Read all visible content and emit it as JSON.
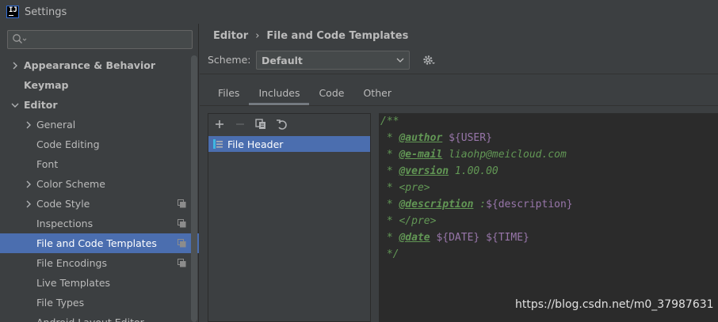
{
  "window": {
    "title": "Settings",
    "logo_text": "IJ"
  },
  "sidebar": {
    "search": {
      "value": "",
      "placeholder": ""
    },
    "items": [
      {
        "label": "Appearance & Behavior",
        "bold": true,
        "chevron": "right",
        "indent": 0
      },
      {
        "label": "Keymap",
        "bold": true,
        "chevron": "",
        "indent": 0
      },
      {
        "label": "Editor",
        "bold": true,
        "chevron": "down",
        "indent": 0
      },
      {
        "label": "General",
        "bold": false,
        "chevron": "right",
        "indent": 1
      },
      {
        "label": "Code Editing",
        "bold": false,
        "chevron": "",
        "indent": 1
      },
      {
        "label": "Font",
        "bold": false,
        "chevron": "",
        "indent": 1
      },
      {
        "label": "Color Scheme",
        "bold": false,
        "chevron": "right",
        "indent": 1
      },
      {
        "label": "Code Style",
        "bold": false,
        "chevron": "right",
        "indent": 1,
        "copy_icon": true
      },
      {
        "label": "Inspections",
        "bold": false,
        "chevron": "",
        "indent": 1,
        "copy_icon": true
      },
      {
        "label": "File and Code Templates",
        "bold": false,
        "chevron": "",
        "indent": 1,
        "copy_icon": true,
        "selected": true
      },
      {
        "label": "File Encodings",
        "bold": false,
        "chevron": "",
        "indent": 1,
        "copy_icon": true
      },
      {
        "label": "Live Templates",
        "bold": false,
        "chevron": "",
        "indent": 1
      },
      {
        "label": "File Types",
        "bold": false,
        "chevron": "",
        "indent": 1
      },
      {
        "label": "Android Layout Editor",
        "bold": false,
        "chevron": "",
        "indent": 1
      }
    ]
  },
  "main": {
    "breadcrumb": {
      "parent": "Editor",
      "separator": "›",
      "current": "File and Code Templates"
    },
    "scheme": {
      "label": "Scheme:",
      "value": "Default"
    },
    "tabs": [
      {
        "label": "Files",
        "active": false
      },
      {
        "label": "Includes",
        "active": true
      },
      {
        "label": "Code",
        "active": false
      },
      {
        "label": "Other",
        "active": false
      }
    ],
    "templates": [
      {
        "label": "File Header",
        "selected": true
      }
    ],
    "editor_lines": [
      {
        "prefix": "/**",
        "tag": "",
        "text": "",
        "vars": []
      },
      {
        "prefix": " * ",
        "tag": "@author",
        "text": " ",
        "var": "${USER}"
      },
      {
        "prefix": " * ",
        "tag": "@e-mail",
        "text": " liaohp@meicloud.com",
        "var": ""
      },
      {
        "prefix": " * ",
        "tag": "@version",
        "text": " 1.00.00",
        "var": ""
      },
      {
        "prefix": " * <pre>",
        "tag": "",
        "text": "",
        "var": ""
      },
      {
        "prefix": " * ",
        "tag": "@description",
        "text": " :",
        "var": "${description}"
      },
      {
        "prefix": " * </pre>",
        "tag": "",
        "text": "",
        "var": ""
      },
      {
        "prefix": " * ",
        "tag": "@date",
        "text": " ",
        "var": "${DATE} ${TIME}"
      },
      {
        "prefix": " */",
        "tag": "",
        "text": "",
        "var": ""
      }
    ]
  },
  "watermark": "https://blog.csdn.net/m0_37987631",
  "colors": {
    "background": "#3c3f41",
    "selection": "#4b6eaf",
    "editor_bg": "#2b2b2b",
    "doc_comment": "#629755",
    "variable": "#9876aa"
  }
}
